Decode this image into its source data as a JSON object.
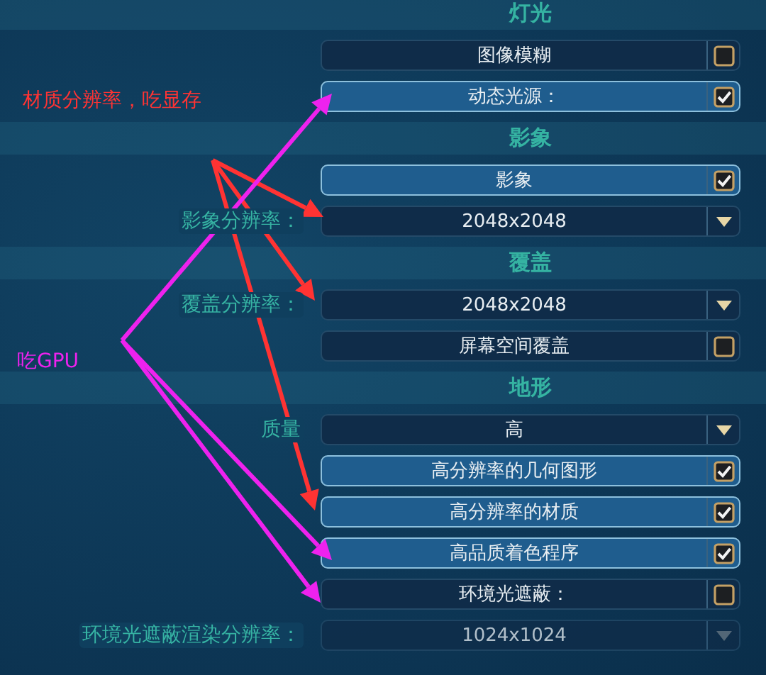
{
  "sections": [
    {
      "title": "灯光",
      "items": [
        {
          "kind": "checkbox",
          "text": "图像模糊",
          "checked": false
        },
        {
          "kind": "checkbox",
          "text": "动态光源：",
          "checked": true
        }
      ]
    },
    {
      "title": "影象",
      "items": [
        {
          "kind": "checkbox",
          "text": "影象",
          "checked": true
        },
        {
          "kind": "dropdown",
          "label": "影象分辨率：",
          "value": "2048x2048",
          "disabled": false
        }
      ]
    },
    {
      "title": "覆盖",
      "items": [
        {
          "kind": "dropdown",
          "label": "覆盖分辨率：",
          "value": "2048x2048",
          "disabled": false
        },
        {
          "kind": "checkbox",
          "text": "屏幕空间覆盖",
          "checked": false
        }
      ]
    },
    {
      "title": "地形",
      "items": [
        {
          "kind": "dropdown",
          "label": "质量",
          "value": "高",
          "disabled": false
        },
        {
          "kind": "checkbox",
          "text": "高分辨率的几何图形",
          "checked": true
        },
        {
          "kind": "checkbox",
          "text": "高分辨率的材质",
          "checked": true
        },
        {
          "kind": "checkbox",
          "text": "高品质着色程序",
          "checked": true
        },
        {
          "kind": "checkbox",
          "text": "环境光遮蔽：",
          "checked": false
        },
        {
          "kind": "dropdown",
          "label": "环境光遮蔽渲染分辨率：",
          "value": "1024x1024",
          "disabled": true
        }
      ]
    }
  ],
  "annotations": [
    {
      "text": "材质分辨率，吃显存",
      "color": "#ff3333"
    },
    {
      "text": "吃GPU",
      "color": "#ee22ee"
    }
  ]
}
